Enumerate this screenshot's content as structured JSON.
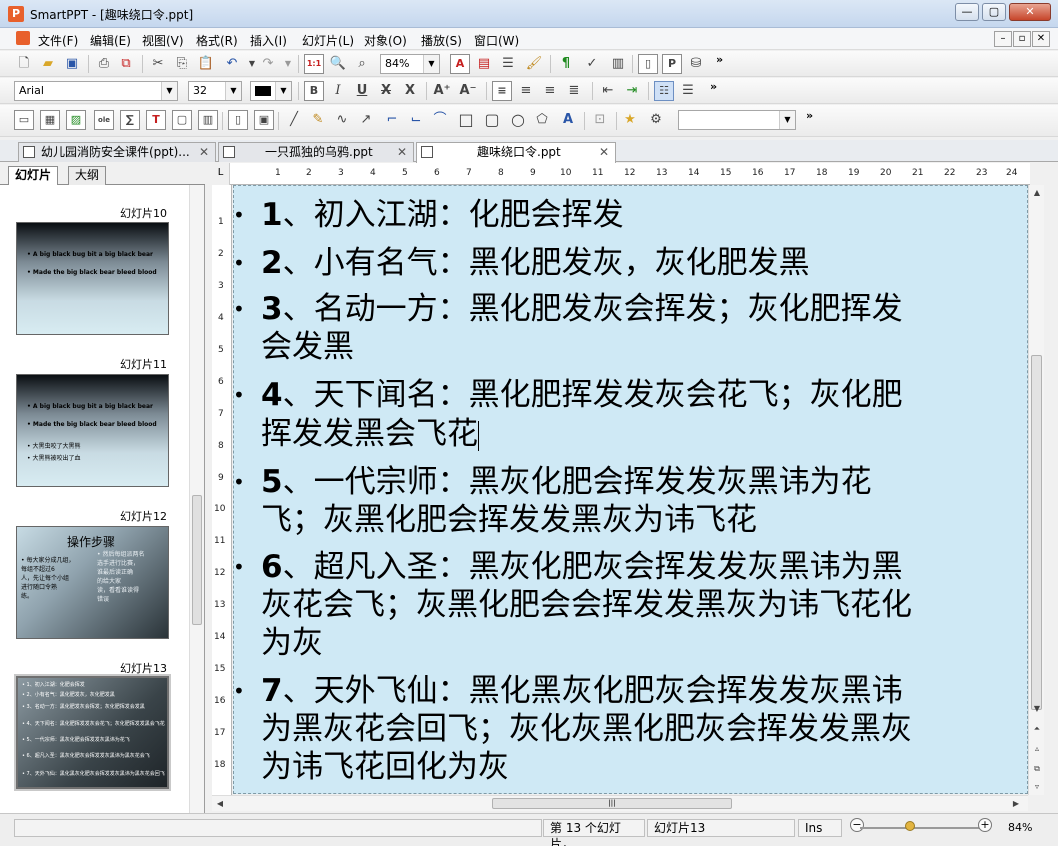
{
  "window": {
    "title": "SmartPPT - [趣味绕口令.ppt]",
    "app_icon": "P",
    "minimize": "—",
    "maximize": "▢",
    "close": "✕"
  },
  "menu": {
    "items": [
      "文件(F)",
      "编辑(E)",
      "视图(V)",
      "格式(R)",
      "插入(I)",
      "幻灯片(L)",
      "对象(O)",
      "播放(S)",
      "窗口(W)"
    ],
    "mdi": [
      "–",
      "▫",
      "✕"
    ]
  },
  "toolbar1": {
    "zoom": "84%"
  },
  "toolbar2": {
    "font": "Arial",
    "size": "32"
  },
  "tabs": [
    {
      "label": "幼儿园消防安全课件(ppt)..."
    },
    {
      "label": "一只孤独的乌鸦.ppt"
    },
    {
      "label": "趣味绕口令.ppt"
    }
  ],
  "panel": {
    "tab_slides": "幻灯片",
    "tab_outline": "大纲",
    "slides": [
      {
        "label": "幻灯片10",
        "lines": [
          "• A big black bug bit a big black bear",
          "• Made the big black bear bleed blood"
        ]
      },
      {
        "label": "幻灯片11",
        "lines": [
          "• A big black bug bit a big black bear",
          "• Made the big black bear bleed blood",
          "• 大黑虫咬了大黑熊",
          "• 大黑熊被咬出了血"
        ]
      },
      {
        "label": "幻灯片12",
        "title": "操作步骤",
        "lines": [
          "• 每大家分成几组，",
          "  每组不超过6",
          "  人，先让每个小组",
          "  进行随口令熟",
          "  练。",
          "• 然后每组派两名",
          "  选手进行比赛，",
          "  谁最后读正确",
          "  的给大家",
          "  读，看看谁读得",
          "  错误"
        ]
      },
      {
        "label": "幻灯片13",
        "lines": [
          "• 1、初入江湖：化肥会挥发",
          "• 2、小有名气：黑化肥发灰，灰化肥发黑",
          "• 3、名动一方：黑化肥发灰会挥发；灰化肥挥发会发黑",
          "• 4、天下闻名：黑化肥挥发发灰会花飞；灰化肥挥发发黑会飞花",
          "• 5、一代宗师：黑灰化肥会挥发发灰黑讳为花飞",
          "• 6、超凡入圣：黑灰化肥灰会挥发发灰黑讳为黑灰花会飞",
          "• 7、天外飞仙：黑化黑灰化肥灰会挥发发灰黑讳为黑灰花会回飞"
        ]
      }
    ]
  },
  "ruler": {
    "h": [
      "1",
      "2",
      "3",
      "4",
      "5",
      "6",
      "7",
      "8",
      "9",
      "10",
      "11",
      "12",
      "13",
      "14",
      "15",
      "16",
      "17",
      "18",
      "19",
      "20",
      "21",
      "22",
      "23",
      "24"
    ],
    "v": [
      "1",
      "2",
      "3",
      "4",
      "5",
      "6",
      "7",
      "8",
      "9",
      "10",
      "11",
      "12",
      "13",
      "14",
      "15",
      "16",
      "17",
      "18"
    ]
  },
  "slide": {
    "lines": [
      {
        "num": "1",
        "text": "、初入江湖：化肥会挥发"
      },
      {
        "num": "2",
        "text": "、小有名气：黑化肥发灰，灰化肥发黑"
      },
      {
        "num": "3",
        "text": "、名动一方：黑化肥发灰会挥发；灰化肥挥发"
      },
      {
        "num": "",
        "text": "会发黑"
      },
      {
        "num": "4",
        "text": "、天下闻名：黑化肥挥发发灰会花飞；灰化肥"
      },
      {
        "num": "",
        "text": "挥发发黑会飞花"
      },
      {
        "num": "5",
        "text": "、一代宗师：黑灰化肥会挥发发灰黑讳为花"
      },
      {
        "num": "",
        "text": "飞；灰黑化肥会挥发发黑灰为讳飞花"
      },
      {
        "num": "6",
        "text": "、超凡入圣：黑灰化肥灰会挥发发灰黑讳为黑"
      },
      {
        "num": "",
        "text": "灰花会飞；灰黑化肥会会挥发发黑灰为讳飞花化"
      },
      {
        "num": "",
        "text": "为灰"
      },
      {
        "num": "7",
        "text": "、天外飞仙：黑化黑灰化肥灰会挥发发灰黑讳"
      },
      {
        "num": "",
        "text": "为黑灰花会回飞；灰化灰黑化肥灰会挥发发黑灰"
      },
      {
        "num": "",
        "text": "为讳飞花回化为灰"
      }
    ]
  },
  "status": {
    "slide_pos": "第 13 个幻灯片，",
    "slide_name": "幻灯片13",
    "mode": "Ins",
    "zoom": "84%"
  },
  "colors": {
    "canvas_bg": "#cfe9f5",
    "title_bar": "#c5d7ee"
  }
}
